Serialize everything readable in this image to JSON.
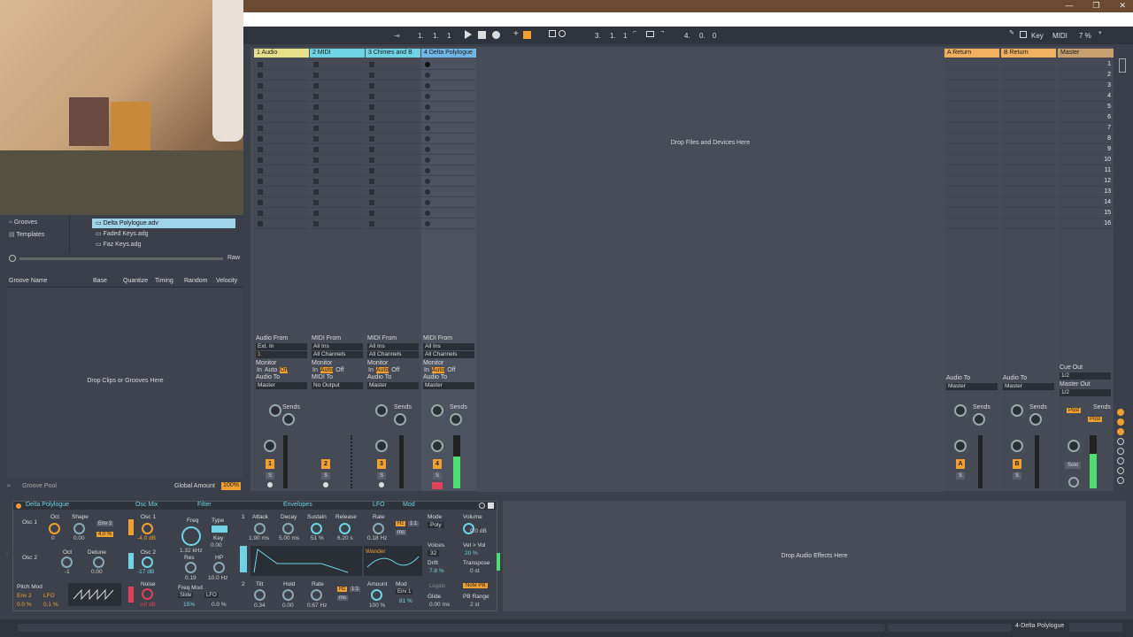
{
  "window": {
    "minimize": "—",
    "restore": "❐",
    "close": "✕"
  },
  "transport": {
    "pos1": "1.",
    "pos2": "1.",
    "pos3": "1",
    "loop1": "3.",
    "loop2": "1.",
    "loop3": "1",
    "len1": "4.",
    "len2": "0.",
    "len3": "0",
    "key_label": "Key",
    "midi_label": "MIDI",
    "cpu": "7 %"
  },
  "browser": {
    "places": [
      {
        "label": "Grooves"
      },
      {
        "label": "Templates"
      }
    ],
    "files": [
      {
        "label": "Delta Polylogue.adv"
      },
      {
        "label": "Faded Keys.adg"
      },
      {
        "label": "Faz Keys.adg"
      }
    ],
    "raw_label": "Raw"
  },
  "groove_pool": {
    "columns": [
      "Groove Name",
      "Base",
      "Quantize",
      "Timing",
      "Random",
      "Velocity"
    ],
    "drop_hint": "Drop Clips or Grooves Here",
    "footer_title": "Groove Pool",
    "global_amount_label": "Global Amount",
    "global_amount_value": "100%"
  },
  "session": {
    "drop_hint": "Drop Files and Devices Here",
    "tracks": [
      {
        "name": "1 Audio",
        "color": "#e8e08a",
        "from_label": "Audio From",
        "from_value": "Ext. In",
        "channel": "1",
        "monitor_label": "Monitor",
        "mon_in": "In",
        "mon_auto": "Auto",
        "mon_off": "Off",
        "to_label": "Audio To",
        "to_value": "Master",
        "num": "1",
        "sends": "Sends"
      },
      {
        "name": "2 MIDI",
        "color": "#6fd3e6",
        "from_label": "MIDI From",
        "from_value": "All Ins",
        "channel": "All Channels",
        "monitor_label": "Monitor",
        "mon_in": "In",
        "mon_auto": "Auto",
        "mon_off": "Off",
        "to_label": "MIDI To",
        "to_value": "No Output",
        "num": "2",
        "sends": ""
      },
      {
        "name": "3 Chimes and B",
        "color": "#6fd3e6",
        "from_label": "MIDI From",
        "from_value": "All Ins",
        "channel": "All Channels",
        "monitor_label": "Monitor",
        "mon_in": "In",
        "mon_auto": "Auto",
        "mon_off": "Off",
        "to_label": "Audio To",
        "to_value": "Master",
        "num": "3",
        "sends": "Sends"
      },
      {
        "name": "4 Delta Polylogue",
        "color": "#6fb8e6",
        "from_label": "MIDI From",
        "from_value": "All Ins",
        "channel": "All Channels",
        "monitor_label": "Monitor",
        "mon_in": "In",
        "mon_auto": "Auto",
        "mon_off": "Off",
        "to_label": "Audio To",
        "to_value": "Master",
        "num": "4",
        "sends": "Sends"
      }
    ],
    "returns": [
      {
        "name": "A Return",
        "color": "#f0b060",
        "to_label": "Audio To",
        "to_value": "Master",
        "num": "A",
        "sends": "Sends"
      },
      {
        "name": "B Return",
        "color": "#f0b060",
        "to_label": "Audio To",
        "to_value": "Master",
        "num": "B",
        "sends": "Sends"
      }
    ],
    "master": {
      "name": "Master",
      "color": "#c8a070",
      "cue_label": "Cue Out",
      "cue_value": "1/2",
      "out_label": "Master Out",
      "out_value": "1/2",
      "sends": "Sends",
      "post": "Post",
      "solo": "Solo"
    },
    "scenes": [
      "1",
      "2",
      "3",
      "4",
      "5",
      "6",
      "7",
      "8",
      "9",
      "10",
      "11",
      "12",
      "13",
      "14",
      "15",
      "16"
    ],
    "sbtn": "S"
  },
  "device": {
    "title": "Delta Polylogue",
    "osc_mix": "Osc Mix",
    "filter": "Filter",
    "envelopes": "Envelopes",
    "lfo": "LFO",
    "mod": "Mod",
    "osc1": "Osc 1",
    "osc2": "Osc 2",
    "oct": "Oct",
    "shape": "Shape",
    "osc1_oct": "0",
    "osc1_shape": "0.00",
    "env2": "Env 2",
    "osc1_env": "4.0 %",
    "osc2_oct": "-1",
    "detune": "Detune",
    "osc2_detune": "0.00",
    "mix1_label": "Osc 1",
    "mix1_val": "-4.0 dB",
    "mix2_label": "Osc 2",
    "mix2_val": "-17 dB",
    "noise_label": "Noise",
    "noise_val": "-inf dB",
    "freq": "Freq",
    "freq_val": "1.32 kHz",
    "type": "Type",
    "key": "Key",
    "key_val": "0.00",
    "res": "Res",
    "res_val": "0.19",
    "hp": "HP",
    "hp_val": "10.0 Hz",
    "freq_mod": "Freq Mod",
    "slide": "Slide",
    "lfo_src": "LFO",
    "fm1": "15%",
    "fm2": "0.0 %",
    "pitch_mod": "Pitch Mod",
    "env2b": "Env 2",
    "lfo2": "LFO",
    "pm1": "0.0 %",
    "pm2": "0.1 %",
    "env_attack": "Attack",
    "env_decay": "Decay",
    "env_sustain": "Sustain",
    "env_release": "Release",
    "attack_val": "1.90 ms",
    "decay_val": "5.00 ms",
    "sustain_val": "51 %",
    "release_val": "6.20 s",
    "tilt": "Tilt",
    "hold": "Hold",
    "rate": "Rate",
    "tilt_val": "0.34",
    "hold_val": "0.00",
    "env2_rate_val": "0.67 Hz",
    "lfo_rate": "Rate",
    "lfo_rate_val": "0.18 Hz",
    "hz": "Hz",
    "ms": "ms",
    "ratio": "1:1",
    "wander": "Wander",
    "amount": "Amount",
    "amount_val": "100 %",
    "lfo_mod": "Mod",
    "env1": "Env 1",
    "mod_val": "81 %",
    "mode": "Mode",
    "mode_val": "Poly",
    "voices": "Voices",
    "voices_val": "32",
    "drift": "Drift",
    "drift_val": "7.8 %",
    "legato": "Legato",
    "glide": "Glide",
    "glide_val": "0.00 ms",
    "volume": "Volume",
    "volume_val": "0.0 dB",
    "vel_vol": "Vel > Vol",
    "vel_vol_val": "20 %",
    "transpose": "Transpose",
    "transpose_val": "0 st",
    "note_pb": "Note PB",
    "pb_range": "PB Range",
    "pb_range_val": "2 st",
    "drop_fx": "Drop Audio Effects Here"
  },
  "status": {
    "track": "4-Delta Polylogue"
  },
  "colors": {
    "accent": "#f0a030",
    "bg": "#3a3f4a",
    "session": "#474c57"
  }
}
